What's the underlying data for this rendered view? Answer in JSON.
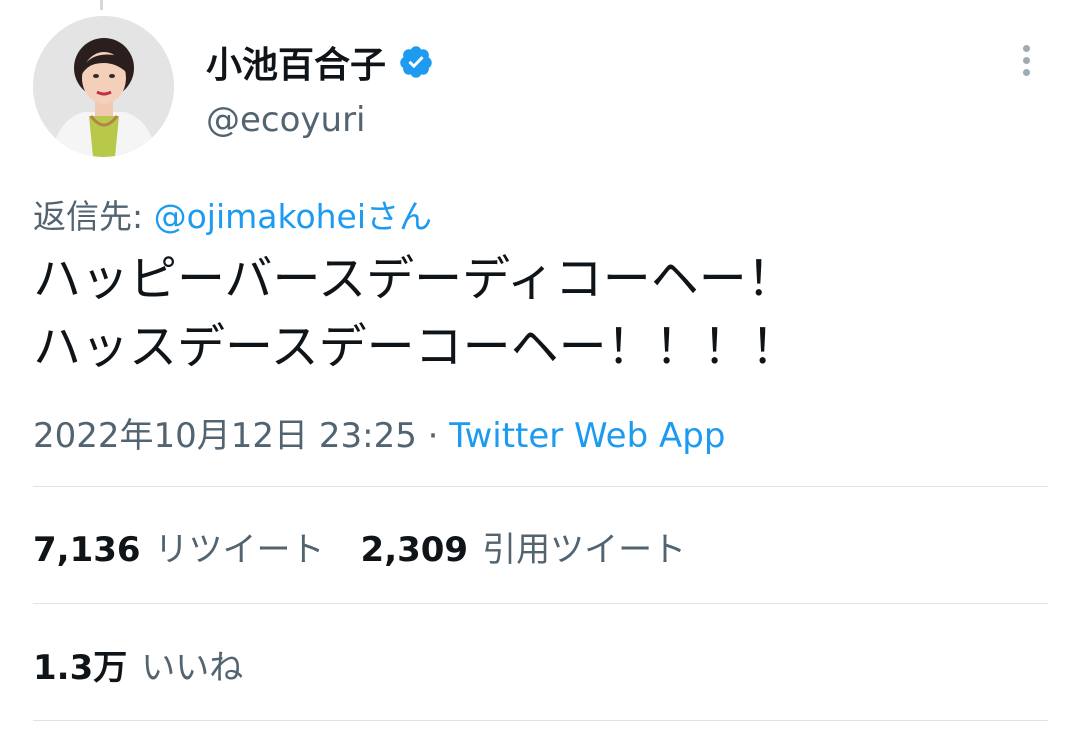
{
  "author": {
    "display_name": "小池百合子",
    "handle": "@ecoyuri",
    "verified": true
  },
  "reply": {
    "prefix": "返信先: ",
    "target": "@ojimakoheiさん"
  },
  "tweet": {
    "lines": [
      "ハッピーバースデーディコーヘー！",
      "ハッスデースデーコーヘー！！！！"
    ]
  },
  "meta": {
    "timestamp": "2022年10月12日 23:25",
    "separator": " · ",
    "source": "Twitter Web App"
  },
  "stats": {
    "retweets": {
      "count": "7,136",
      "label": "リツイート"
    },
    "quotes": {
      "count": "2,309",
      "label": "引用ツイート"
    },
    "likes": {
      "count": "1.3万",
      "label": "いいね"
    }
  },
  "colors": {
    "accent": "#1d9bf0",
    "secondary_text": "#536471",
    "primary_text": "#0f1419"
  }
}
